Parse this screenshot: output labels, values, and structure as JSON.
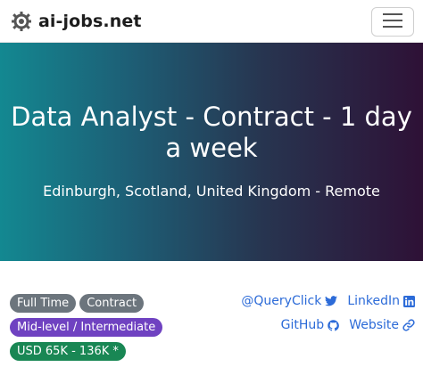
{
  "navbar": {
    "brand": "ai-jobs.net",
    "logo_icon": "gear-network-icon",
    "menu_icon": "hamburger-menu-icon"
  },
  "hero": {
    "title": "Data Analyst - Contract - 1 day a week",
    "location": "Edinburgh, Scotland, United Kingdom - Remote",
    "gradient_colors": [
      "#138891",
      "#273550",
      "#2e1136"
    ]
  },
  "badges": {
    "employment_types": [
      "Full Time",
      "Contract"
    ],
    "level": "Mid-level / Intermediate",
    "salary": "USD 65K - 136K *"
  },
  "company_links": {
    "twitter": "@QueryClick",
    "linkedin": "LinkedIn",
    "github": "GitHub",
    "website": "Website"
  },
  "colors": {
    "link": "#2c6bd8",
    "badge_grey": "#6c757d",
    "badge_purple": "#6f42c1",
    "badge_green": "#198754"
  }
}
